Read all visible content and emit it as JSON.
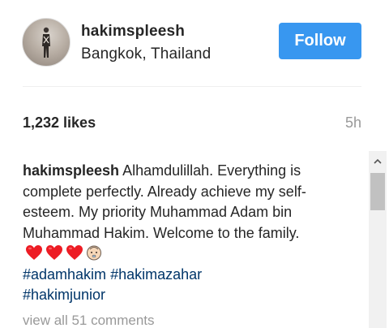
{
  "header": {
    "username": "hakimspleesh",
    "location": "Bangkok, Thailand",
    "follow_label": "Follow",
    "avatar_icon": "profile-photo"
  },
  "stats": {
    "likes": "1,232 likes",
    "time_ago": "5h"
  },
  "caption": {
    "username": "hakimspleesh",
    "text": "Alhamdulillah. Everything is complete perfectly. Already achieve my self-esteem. My priority Muhammad Adam bin Muhammad Hakim. Welcome to the family.",
    "emojis": [
      "red-heart-emoji",
      "red-heart-emoji",
      "red-heart-emoji",
      "baby-emoji"
    ],
    "hashtags": [
      "#adamhakim",
      "#hakimazahar",
      "#hakimjunior"
    ]
  },
  "comments": {
    "view_all": "view all 51 comments"
  },
  "colors": {
    "follow_bg": "#3897f0",
    "hashtag": "#003569",
    "muted": "#999999",
    "heart": "#ed1c24"
  }
}
